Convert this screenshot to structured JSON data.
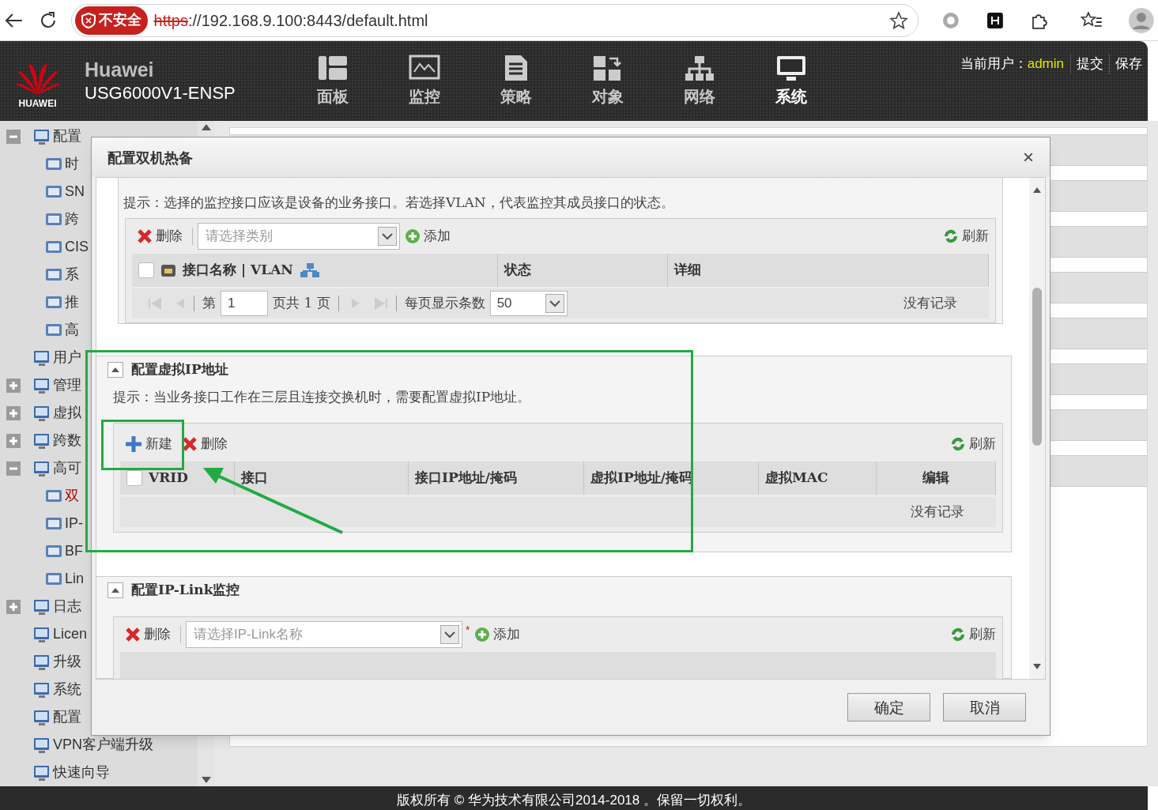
{
  "browser": {
    "security": "不安全",
    "url_scheme": "https",
    "url_rest": "://192.168.9.100:8443/default.html"
  },
  "header": {
    "logo_text": "HUAWEI",
    "brand": "Huawei",
    "model": "USG6000V1-ENSP",
    "nav": [
      {
        "label": "面板",
        "selected": false
      },
      {
        "label": "监控",
        "selected": false
      },
      {
        "label": "策略",
        "selected": false
      },
      {
        "label": "对象",
        "selected": false
      },
      {
        "label": "网络",
        "selected": false
      },
      {
        "label": "系统",
        "selected": true
      }
    ],
    "user_label": "当前用户：",
    "user": "admin",
    "actions": [
      "提交",
      "保存"
    ]
  },
  "sidebar": {
    "items": [
      {
        "label": "配置",
        "expanded": true,
        "children": [
          {
            "label": "时",
            "selected": false
          },
          {
            "label": "SN",
            "selected": false
          },
          {
            "label": "跨",
            "selected": false
          },
          {
            "label": "CIS",
            "selected": false
          },
          {
            "label": "系",
            "selected": false
          },
          {
            "label": "推",
            "selected": false
          },
          {
            "label": "高",
            "selected": false
          }
        ]
      },
      {
        "label": "用户"
      },
      {
        "label": "管理",
        "expanded": false
      },
      {
        "label": "虚拟",
        "expanded": false
      },
      {
        "label": "跨数",
        "expanded": false
      },
      {
        "label": "高可",
        "expanded": true,
        "children": [
          {
            "label": "双",
            "selected": true
          },
          {
            "label": "IP-",
            "selected": false
          },
          {
            "label": "BF",
            "selected": false
          },
          {
            "label": "Lin",
            "selected": false
          }
        ]
      },
      {
        "label": "日志",
        "expanded": false
      },
      {
        "label": "Licen"
      },
      {
        "label": "升级"
      },
      {
        "label": "系统"
      },
      {
        "label": "配置"
      },
      {
        "label": "VPN客户端升级"
      },
      {
        "label": "快速向导"
      }
    ]
  },
  "dialog": {
    "title": "配置双机热备",
    "close": "×",
    "sections": [
      {
        "kind": "monitor",
        "hint": "提示：选择的监控接口应该是设备的业务接口。若选择VLAN，代表监控其成员接口的状态。",
        "toolbar": [
          {
            "kind": "delete",
            "label": "删除"
          },
          {
            "kind": "select",
            "placeholder": "请选择类别"
          },
          {
            "kind": "add",
            "label": "添加"
          }
        ],
        "refresh": "刷新",
        "all_checked": false,
        "columns": [
          "接口名称 | VLAN",
          "状态",
          "详细"
        ],
        "pager": {
          "page_label": "第",
          "page": "1",
          "total": "页共 1 页",
          "per_page_label": "每页显示条数",
          "per_page": "50",
          "empty": "没有记录"
        }
      },
      {
        "kind": "vip",
        "title": "配置虚拟IP地址",
        "expanded": true,
        "hint": "提示：当业务接口工作在三层且连接交换机时，需要配置虚拟IP地址。",
        "toolbar": [
          {
            "kind": "new",
            "label": "新建"
          },
          {
            "kind": "delete",
            "label": "删除"
          }
        ],
        "refresh": "刷新",
        "all_checked": false,
        "columns": [
          "VRID",
          "接口",
          "接口IP地址/掩码",
          "虚拟IP地址/掩码",
          "虚拟MAC",
          "编辑"
        ],
        "empty": "没有记录"
      },
      {
        "kind": "iplink",
        "title": "配置IP-Link监控",
        "expanded": true,
        "toolbar": [
          {
            "kind": "delete",
            "label": "删除"
          },
          {
            "kind": "select",
            "placeholder": "请选择IP-Link名称",
            "required_mark": "*"
          },
          {
            "kind": "add",
            "label": "添加"
          }
        ],
        "refresh": "刷新"
      }
    ],
    "buttons": [
      "确定",
      "取消"
    ]
  },
  "footer": "版权所有 © 华为技术有限公司2014-2018 。保留一切权利。"
}
